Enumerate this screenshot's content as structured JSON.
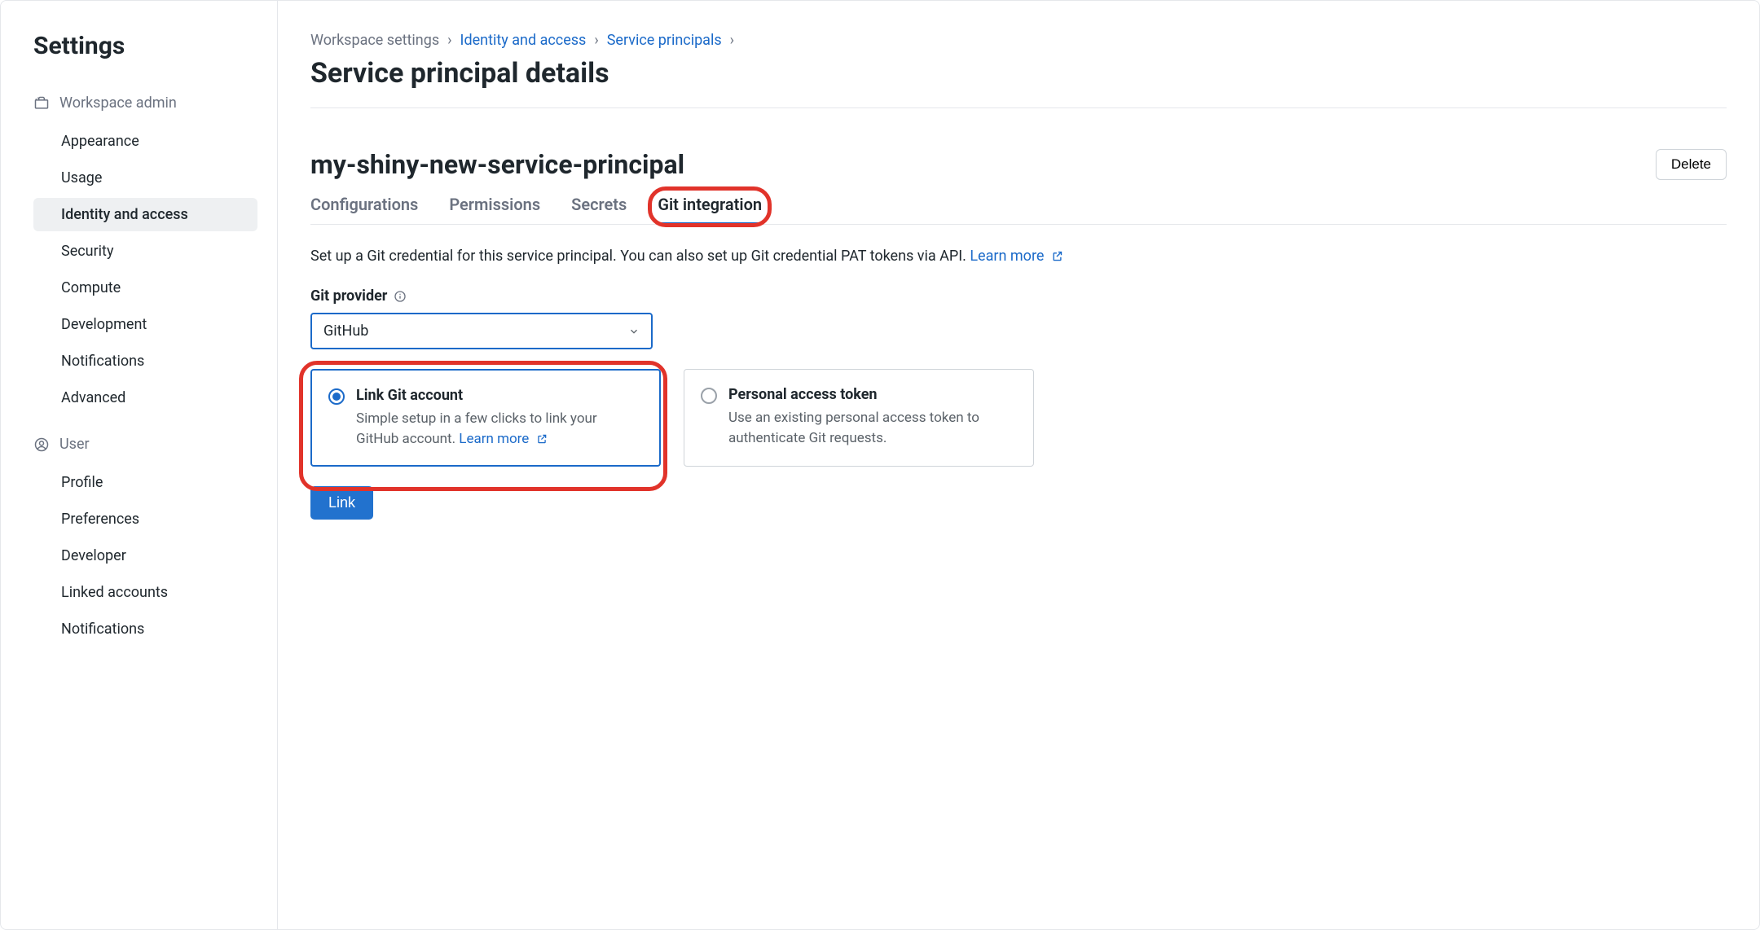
{
  "sidebar": {
    "title": "Settings",
    "sections": [
      {
        "heading": "Workspace admin",
        "icon": "workspace-admin-icon",
        "items": [
          {
            "label": "Appearance",
            "active": false
          },
          {
            "label": "Usage",
            "active": false
          },
          {
            "label": "Identity and access",
            "active": true
          },
          {
            "label": "Security",
            "active": false
          },
          {
            "label": "Compute",
            "active": false
          },
          {
            "label": "Development",
            "active": false
          },
          {
            "label": "Notifications",
            "active": false
          },
          {
            "label": "Advanced",
            "active": false
          }
        ]
      },
      {
        "heading": "User",
        "icon": "user-icon",
        "items": [
          {
            "label": "Profile",
            "active": false
          },
          {
            "label": "Preferences",
            "active": false
          },
          {
            "label": "Developer",
            "active": false
          },
          {
            "label": "Linked accounts",
            "active": false
          },
          {
            "label": "Notifications",
            "active": false
          }
        ]
      }
    ]
  },
  "breadcrumbs": {
    "items": [
      {
        "label": "Workspace settings",
        "link": false
      },
      {
        "label": "Identity and access",
        "link": true
      },
      {
        "label": "Service principals",
        "link": true
      }
    ]
  },
  "page": {
    "title": "Service principal details",
    "entity_name": "my-shiny-new-service-principal",
    "delete_label": "Delete"
  },
  "tabs": [
    {
      "label": "Configurations",
      "active": false
    },
    {
      "label": "Permissions",
      "active": false
    },
    {
      "label": "Secrets",
      "active": false
    },
    {
      "label": "Git integration",
      "active": true
    }
  ],
  "git": {
    "description": "Set up a Git credential for this service principal. You can also set up Git credential PAT tokens via API.",
    "learn_more": "Learn more",
    "provider_label": "Git provider",
    "provider_selected": "GitHub",
    "options": [
      {
        "title": "Link Git account",
        "desc_prefix": "Simple setup in a few clicks to link your GitHub account. ",
        "learn_more": "Learn more",
        "selected": true
      },
      {
        "title": "Personal access token",
        "desc": "Use an existing personal access token to authenticate Git requests.",
        "selected": false
      }
    ],
    "link_button": "Link"
  }
}
